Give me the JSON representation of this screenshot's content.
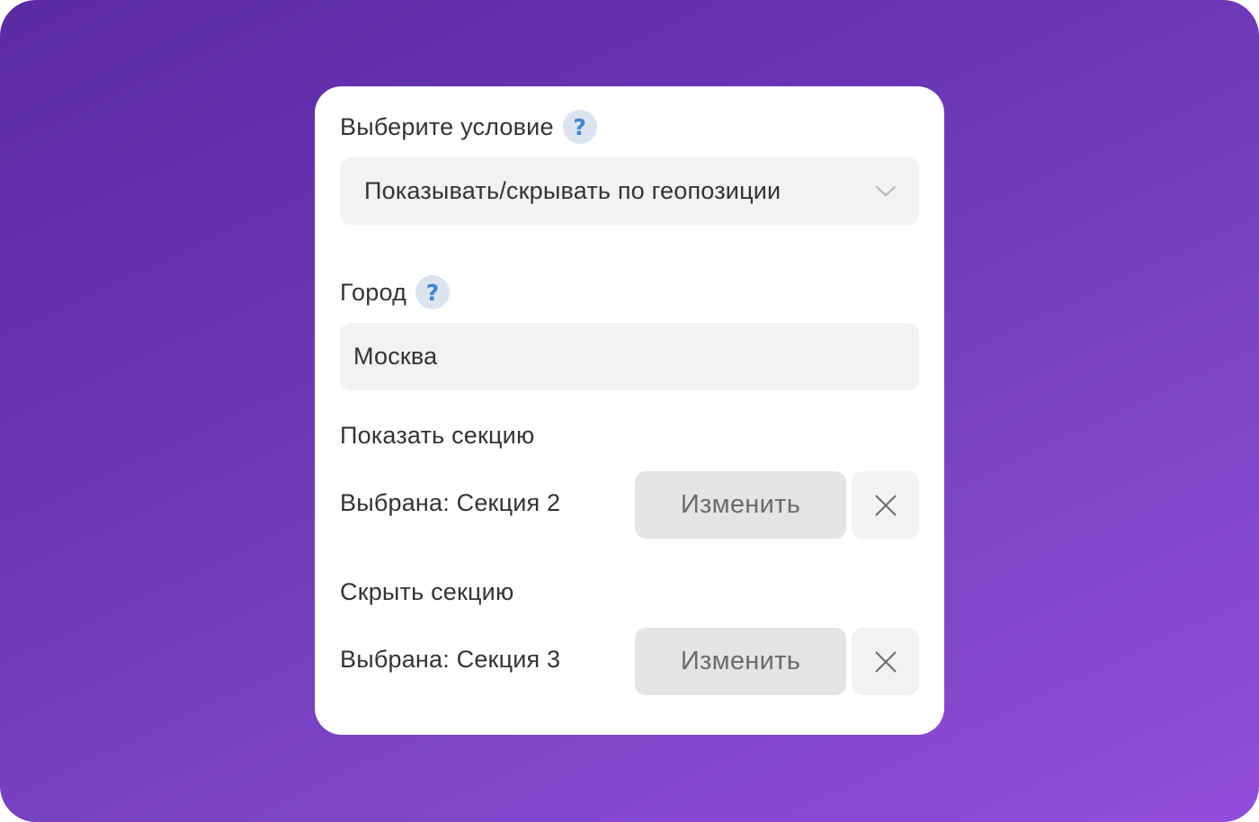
{
  "condition": {
    "label": "Выберите условие",
    "help_icon": "question-mark-icon",
    "selected": "Показывать/скрывать по геопозиции",
    "dropdown_icon": "chevron-down-icon"
  },
  "city": {
    "label": "Город",
    "help_icon": "question-mark-icon",
    "value": "Москва"
  },
  "show_section": {
    "title": "Показать секцию",
    "selected_text": "Выбрана: Секция 2",
    "change_label": "Изменить",
    "clear_icon": "close-icon"
  },
  "hide_section": {
    "title": "Скрыть секцию",
    "selected_text": "Выбрана: Секция 3",
    "change_label": "Изменить",
    "clear_icon": "close-icon"
  },
  "colors": {
    "background_gradient_start": "#5a2aa3",
    "background_gradient_end": "#924ddb",
    "card": "#ffffff",
    "field": "#f2f2f2",
    "button": "#e4e4e4",
    "help_icon_bg": "#dbe3ee",
    "help_icon_fg": "#3b86d6"
  }
}
